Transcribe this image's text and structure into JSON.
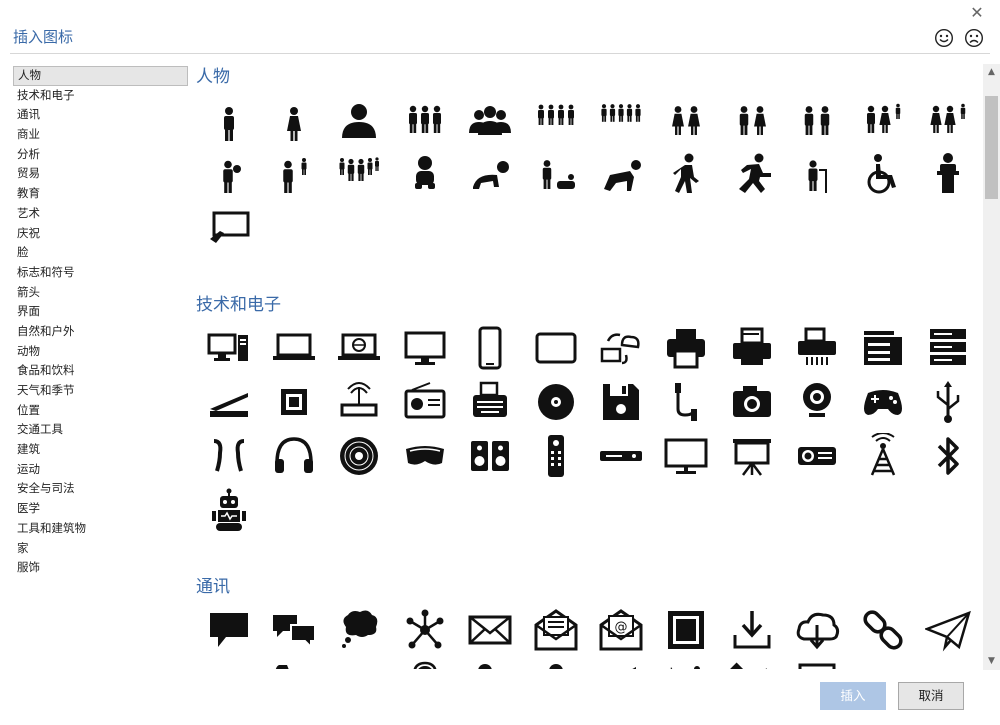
{
  "dialog": {
    "title": "插入图标",
    "close_symbol": "✕"
  },
  "categories": [
    "人物",
    "技术和电子",
    "通讯",
    "商业",
    "分析",
    "贸易",
    "教育",
    "艺术",
    "庆祝",
    "脸",
    "标志和符号",
    "箭头",
    "界面",
    "自然和户外",
    "动物",
    "食品和饮料",
    "天气和季节",
    "位置",
    "交通工具",
    "建筑",
    "运动",
    "安全与司法",
    "医学",
    "工具和建筑物",
    "家",
    "服饰"
  ],
  "selected_category": "人物",
  "sections": [
    {
      "title": "人物",
      "icons": [
        "man",
        "woman",
        "user",
        "group-of-three",
        "group-bust",
        "group-of-four",
        "group-of-five",
        "two-women",
        "couple",
        "two-men",
        "family-man-child",
        "family-women-child",
        "father-with-baby",
        "father-with-child",
        "family-of-five",
        "baby",
        "crawling-baby",
        "diaper-change",
        "crawling-person",
        "walking",
        "running",
        "elderly-with-cane",
        "wheelchair",
        "speaker-at-podium",
        "presentation-touch"
      ]
    },
    {
      "title": "技术和电子",
      "icons": [
        "desktop-computer",
        "laptop",
        "laptop-globe",
        "monitor",
        "smartphone",
        "tablet",
        "cloud-sync",
        "printer",
        "printer-document",
        "fax-printer",
        "copier",
        "server",
        "scanner",
        "cpu-chip",
        "router",
        "radio",
        "typewriter",
        "disc",
        "floppy-disk",
        "usb-cable",
        "camera",
        "webcam",
        "game-controller",
        "usb-symbol",
        "earbuds",
        "headphones",
        "vinyl-record",
        "vr-headset",
        "speakers",
        "remote-control",
        "dvd-player",
        "television",
        "projector-screen",
        "projector",
        "radio-tower",
        "bluetooth",
        "robot"
      ]
    },
    {
      "title": "通讯",
      "icons": [
        "speech-bubble",
        "conversation-bubbles",
        "thought-bubble",
        "network-hub",
        "envelope",
        "open-envelope-letter",
        "open-envelope-at",
        "postage-stamp",
        "download-tray",
        "cloud-download",
        "link-chain",
        "paper-plane",
        "share-arrow",
        "phone-handset",
        "rotary-phone",
        "operator-headset",
        "microphone",
        "studio-microphone",
        "megaphone",
        "satellite-dish",
        "satellite",
        "newspaper"
      ]
    }
  ],
  "buttons": {
    "insert": "插入",
    "cancel": "取消"
  }
}
